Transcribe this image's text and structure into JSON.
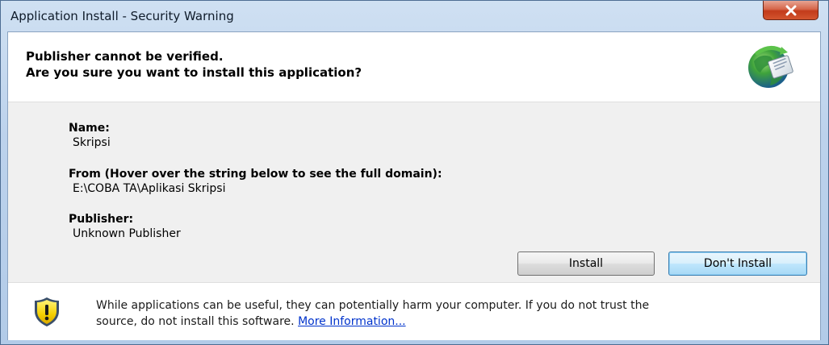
{
  "window": {
    "title": "Application Install - Security Warning"
  },
  "header": {
    "line1": "Publisher cannot be verified.",
    "line2": "Are you sure you want to install this application?"
  },
  "details": {
    "name_label": "Name:",
    "name_value": "Skripsi",
    "from_label": "From (Hover over the string below to see the full domain):",
    "from_value": "E:\\COBA TA\\Aplikasi Skripsi",
    "publisher_label": "Publisher:",
    "publisher_value": "Unknown Publisher"
  },
  "buttons": {
    "install": "Install",
    "dont_install": "Don't Install"
  },
  "footer": {
    "warning_line1": "While applications can be useful, they can potentially harm your computer. If you do not trust the",
    "warning_line2": "source, do not install this software.",
    "link": "More Information..."
  },
  "icons": {
    "close": "close-icon",
    "app": "clickonce-globe-icon",
    "warning": "warning-shield-icon"
  },
  "colors": {
    "close_button": "#c23b1b",
    "link": "#0033cc",
    "default_button_border": "#3c7fb1",
    "shield_yellow": "#f5d000"
  }
}
